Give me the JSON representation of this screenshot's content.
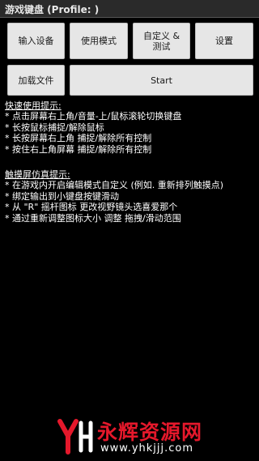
{
  "window": {
    "title": "游戏键盘 (Profile: )"
  },
  "buttons": {
    "input_device": "输入设备",
    "use_mode": "使用模式",
    "custom_test_line1": "自定义 &",
    "custom_test_line2": "测试",
    "settings": "设置",
    "load_file": "加载文件",
    "start": "Start"
  },
  "quick_tips": {
    "heading": "快速使用提示:",
    "lines": [
      "* 点击屏幕右上角/音量-上/鼠标滚轮切换键盘",
      "* 长按鼠标捕捉/解除鼠标",
      "* 长按屏幕右上角 捕捉/解除所有控制",
      "* 按住右上角屏幕 捕捉/解除所有控制"
    ]
  },
  "touch_tips": {
    "heading": "触摸屏仿真提示:",
    "lines": [
      "* 在游戏内开启编辑模式自定义 (例如. 重新排列触摸点)",
      "* 绑定输出到小键盘按键滑动",
      "* 从 \"R\" 摇杆图标 更改视野镜头选喜爱那个",
      "* 通过重新调整图标大小 调整 拖拽/滑动范围"
    ]
  },
  "watermark": {
    "site_name": "永辉资源网",
    "url": "www.yhkjjj.com",
    "colors": {
      "red": "#e5182b",
      "white": "#ffffff"
    }
  }
}
